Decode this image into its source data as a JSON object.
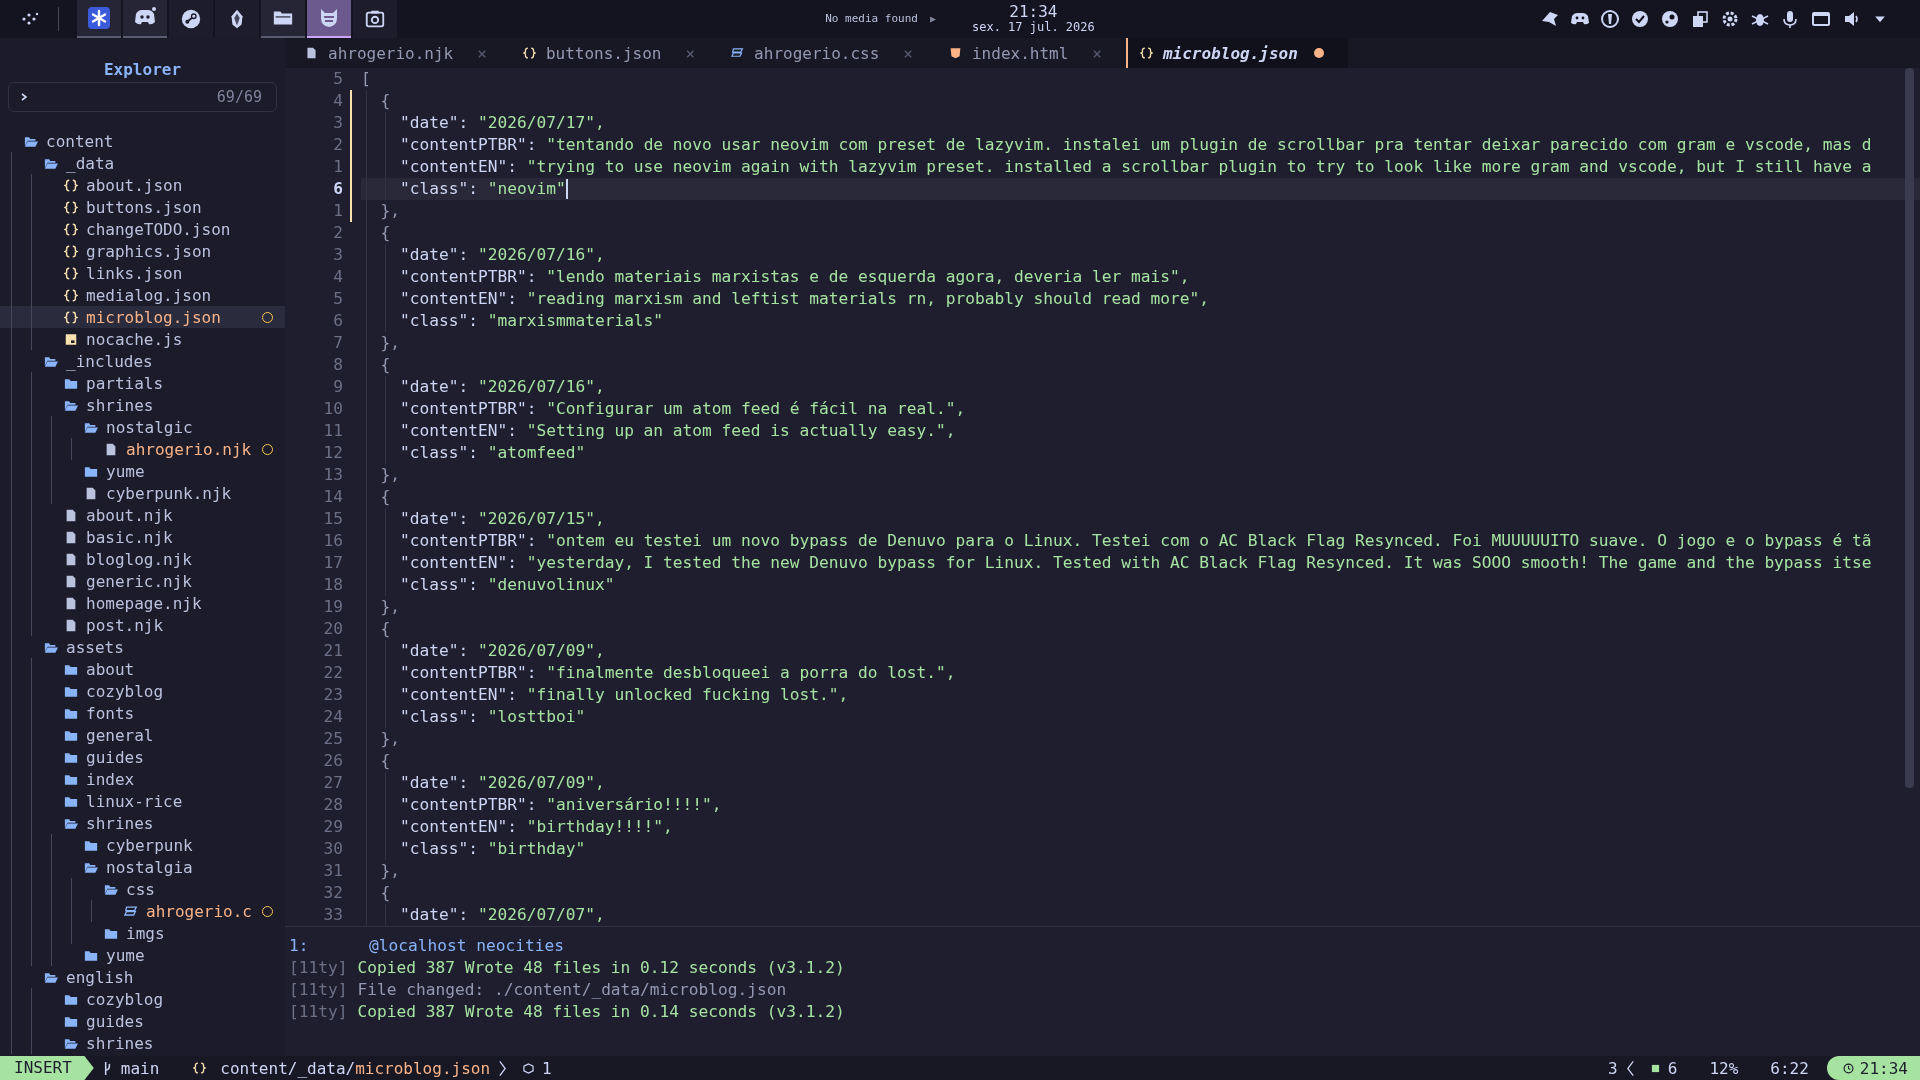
{
  "top_bar": {
    "apps": [
      {
        "selected": false,
        "open": true
      },
      {
        "selected": false,
        "open": true
      },
      {
        "selected": false,
        "open": false
      },
      {
        "selected": false,
        "open": false
      },
      {
        "selected": false,
        "open": true
      },
      {
        "selected": true,
        "open": true
      },
      {
        "selected": false,
        "open": false
      }
    ],
    "media": "No media found",
    "media_button": "▶",
    "time": "21:34",
    "date": "sex. 17 jul. 2026"
  },
  "sidebar": {
    "title": "Explorer",
    "count": "69/69",
    "tree": [
      {
        "name": "content",
        "kind": "folder",
        "expanded": true,
        "selected": false,
        "modified": false,
        "children": [
          {
            "name": "_data",
            "kind": "folder",
            "expanded": true,
            "selected": false,
            "modified": false,
            "children": [
              {
                "name": "about.json",
                "kind": "json",
                "selected": false,
                "modified": false
              },
              {
                "name": "buttons.json",
                "kind": "json",
                "selected": false,
                "modified": false
              },
              {
                "name": "changeTODO.json",
                "kind": "json",
                "selected": false,
                "modified": false
              },
              {
                "name": "graphics.json",
                "kind": "json",
                "selected": false,
                "modified": false
              },
              {
                "name": "links.json",
                "kind": "json",
                "selected": false,
                "modified": false
              },
              {
                "name": "medialog.json",
                "kind": "json",
                "selected": false,
                "modified": false
              },
              {
                "name": "microblog.json",
                "kind": "json",
                "selected": true,
                "modified": true
              },
              {
                "name": "nocache.js",
                "kind": "js",
                "selected": false,
                "modified": false
              }
            ]
          },
          {
            "name": "_includes",
            "kind": "folder",
            "expanded": true,
            "selected": false,
            "modified": false,
            "children": [
              {
                "name": "partials",
                "kind": "folder",
                "expanded": false,
                "selected": false,
                "modified": false
              },
              {
                "name": "shrines",
                "kind": "folder",
                "expanded": true,
                "selected": false,
                "modified": false,
                "children": [
                  {
                    "name": "nostalgic",
                    "kind": "folder",
                    "expanded": true,
                    "selected": false,
                    "modified": false,
                    "children": [
                      {
                        "name": "ahrogerio.njk",
                        "kind": "file",
                        "selected": false,
                        "modified": true
                      }
                    ]
                  },
                  {
                    "name": "yume",
                    "kind": "folder",
                    "expanded": false,
                    "selected": false,
                    "modified": false
                  },
                  {
                    "name": "cyberpunk.njk",
                    "kind": "file",
                    "selected": false,
                    "modified": false
                  }
                ]
              },
              {
                "name": "about.njk",
                "kind": "file",
                "selected": false,
                "modified": false
              },
              {
                "name": "basic.njk",
                "kind": "file",
                "selected": false,
                "modified": false
              },
              {
                "name": "bloglog.njk",
                "kind": "file",
                "selected": false,
                "modified": false
              },
              {
                "name": "generic.njk",
                "kind": "file",
                "selected": false,
                "modified": false
              },
              {
                "name": "homepage.njk",
                "kind": "file",
                "selected": false,
                "modified": false
              },
              {
                "name": "post.njk",
                "kind": "file",
                "selected": false,
                "modified": false
              }
            ]
          },
          {
            "name": "assets",
            "kind": "folder",
            "expanded": true,
            "selected": false,
            "modified": false,
            "children": [
              {
                "name": "about",
                "kind": "folder",
                "expanded": false,
                "selected": false,
                "modified": false
              },
              {
                "name": "cozyblog",
                "kind": "folder",
                "expanded": false,
                "selected": false,
                "modified": false
              },
              {
                "name": "fonts",
                "kind": "folder",
                "expanded": false,
                "selected": false,
                "modified": false
              },
              {
                "name": "general",
                "kind": "folder",
                "expanded": false,
                "selected": false,
                "modified": false
              },
              {
                "name": "guides",
                "kind": "folder",
                "expanded": false,
                "selected": false,
                "modified": false
              },
              {
                "name": "index",
                "kind": "folder",
                "expanded": false,
                "selected": false,
                "modified": false
              },
              {
                "name": "linux-rice",
                "kind": "folder",
                "expanded": false,
                "selected": false,
                "modified": false
              },
              {
                "name": "shrines",
                "kind": "folder",
                "expanded": true,
                "selected": false,
                "modified": false,
                "children": [
                  {
                    "name": "cyberpunk",
                    "kind": "folder",
                    "expanded": false,
                    "selected": false,
                    "modified": false
                  },
                  {
                    "name": "nostalgia",
                    "kind": "folder",
                    "expanded": true,
                    "selected": false,
                    "modified": false,
                    "children": [
                      {
                        "name": "css",
                        "kind": "folder",
                        "expanded": true,
                        "selected": false,
                        "modified": false,
                        "children": [
                          {
                            "name": "ahrogerio.c",
                            "kind": "css",
                            "selected": false,
                            "modified": true
                          }
                        ]
                      },
                      {
                        "name": "imgs",
                        "kind": "folder",
                        "expanded": false,
                        "selected": false,
                        "modified": false
                      }
                    ]
                  },
                  {
                    "name": "yume",
                    "kind": "folder",
                    "expanded": false,
                    "selected": false,
                    "modified": false
                  }
                ]
              }
            ]
          },
          {
            "name": "english",
            "kind": "folder",
            "expanded": true,
            "selected": false,
            "modified": false,
            "children": [
              {
                "name": "cozyblog",
                "kind": "folder",
                "expanded": false,
                "selected": false,
                "modified": false
              },
              {
                "name": "guides",
                "kind": "folder",
                "expanded": false,
                "selected": false,
                "modified": false
              },
              {
                "name": "shrines",
                "kind": "folder",
                "expanded": true,
                "selected": false,
                "modified": false
              }
            ]
          }
        ]
      }
    ]
  },
  "tabs": [
    {
      "label": "ahrogerio.njk",
      "kind": "file",
      "selected": false,
      "modified": false,
      "close": "×"
    },
    {
      "label": "buttons.json",
      "kind": "json",
      "selected": false,
      "modified": false,
      "close": "×"
    },
    {
      "label": "ahrogerio.css",
      "kind": "css",
      "selected": false,
      "modified": false,
      "close": "×"
    },
    {
      "label": "index.html",
      "kind": "html",
      "selected": false,
      "modified": false,
      "close": "×"
    },
    {
      "label": "microblog.json",
      "kind": "json",
      "selected": true,
      "modified": true
    }
  ],
  "code": {
    "first": {
      "number": "5",
      "text": "["
    },
    "entries": [
      {
        "changed": true,
        "open": {
          "number": "4",
          "text": "{"
        },
        "fields": [
          {
            "number": "3",
            "key": "\"date\":",
            "value": "\"2026/07/17\",",
            "current": false
          },
          {
            "number": "2",
            "key": "\"contentPTBR\":",
            "value": "\"tentando de novo usar neovim com preset de lazyvim. instalei um plugin de scrollbar pra tentar deixar parecido com gram e vscode, mas d",
            "current": false
          },
          {
            "number": "1",
            "key": "\"contentEN\":",
            "value": "\"trying to use neovim again with lazyvim preset. installed a scrollbar plugin to try to look like more gram and vscode, but I still have a",
            "current": false
          },
          {
            "number": "6",
            "key": "\"class\":",
            "value": "\"neovim\"",
            "current": true
          }
        ],
        "close": {
          "number": "1",
          "text": "},"
        }
      },
      {
        "changed": false,
        "open": {
          "number": "2",
          "text": "{"
        },
        "fields": [
          {
            "number": "3",
            "key": "\"date\":",
            "value": "\"2026/07/16\",",
            "current": false
          },
          {
            "number": "4",
            "key": "\"contentPTBR\":",
            "value": "\"lendo materiais marxistas e de esquerda agora, deveria ler mais\",",
            "current": false
          },
          {
            "number": "5",
            "key": "\"contentEN\":",
            "value": "\"reading marxism and leftist materials rn, probably should read more\",",
            "current": false
          },
          {
            "number": "6",
            "key": "\"class\":",
            "value": "\"marxismmaterials\"",
            "current": false
          }
        ],
        "close": {
          "number": "7",
          "text": "},"
        }
      },
      {
        "changed": false,
        "open": {
          "number": "8",
          "text": "{"
        },
        "fields": [
          {
            "number": "9",
            "key": "\"date\":",
            "value": "\"2026/07/16\",",
            "current": false
          },
          {
            "number": "10",
            "key": "\"contentPTBR\":",
            "value": "\"Configurar um atom feed é fácil na real.\",",
            "current": false
          },
          {
            "number": "11",
            "key": "\"contentEN\":",
            "value": "\"Setting up an atom feed is actually easy.\",",
            "current": false
          },
          {
            "number": "12",
            "key": "\"class\":",
            "value": "\"atomfeed\"",
            "current": false
          }
        ],
        "close": {
          "number": "13",
          "text": "},"
        }
      },
      {
        "changed": false,
        "open": {
          "number": "14",
          "text": "{"
        },
        "fields": [
          {
            "number": "15",
            "key": "\"date\":",
            "value": "\"2026/07/15\",",
            "current": false
          },
          {
            "number": "16",
            "key": "\"contentPTBR\":",
            "value": "\"ontem eu testei um novo bypass de Denuvo para o Linux. Testei com o AC Black Flag Resynced. Foi MUUUUUITO suave. O jogo e o bypass é tã",
            "current": false
          },
          {
            "number": "17",
            "key": "\"contentEN\":",
            "value": "\"yesterday, I tested the new Denuvo bypass for Linux. Tested with AC Black Flag Resynced. It was SOOO smooth! The game and the bypass itse",
            "current": false
          },
          {
            "number": "18",
            "key": "\"class\":",
            "value": "\"denuvolinux\"",
            "current": false
          }
        ],
        "close": {
          "number": "19",
          "text": "},"
        }
      },
      {
        "changed": false,
        "open": {
          "number": "20",
          "text": "{"
        },
        "fields": [
          {
            "number": "21",
            "key": "\"date\":",
            "value": "\"2026/07/09\",",
            "current": false
          },
          {
            "number": "22",
            "key": "\"contentPTBR\":",
            "value": "\"finalmente desbloqueei a porra do lost.\",",
            "current": false
          },
          {
            "number": "23",
            "key": "\"contentEN\":",
            "value": "\"finally unlocked fucking lost.\",",
            "current": false
          },
          {
            "number": "24",
            "key": "\"class\":",
            "value": "\"losttboi\"",
            "current": false
          }
        ],
        "close": {
          "number": "25",
          "text": "},"
        }
      },
      {
        "changed": false,
        "open": {
          "number": "26",
          "text": "{"
        },
        "fields": [
          {
            "number": "27",
            "key": "\"date\":",
            "value": "\"2026/07/09\",",
            "current": false
          },
          {
            "number": "28",
            "key": "\"contentPTBR\":",
            "value": "\"aniversário!!!!\",",
            "current": false
          },
          {
            "number": "29",
            "key": "\"contentEN\":",
            "value": "\"birthday!!!!\",",
            "current": false
          },
          {
            "number": "30",
            "key": "\"class\":",
            "value": "\"birthday\"",
            "current": false
          }
        ],
        "close": {
          "number": "31",
          "text": "},"
        }
      },
      {
        "changed": false,
        "open": {
          "number": "32",
          "text": "{"
        },
        "fields": [
          {
            "number": "33",
            "key": "\"date\":",
            "value": "\"2026/07/07\",",
            "current": false
          }
        ]
      }
    ]
  },
  "terminal": {
    "header": {
      "number": "1:",
      "text": "@localhost neocities"
    },
    "lines": [
      {
        "prefix": "[11ty]",
        "text": "Copied 387 Wrote 48 files in 0.12 seconds (v3.1.2)",
        "kind": "success"
      },
      {
        "prefix": "[11ty]",
        "text": "File changed: ./content/_data/microblog.json",
        "kind": "info"
      },
      {
        "prefix": "[11ty]",
        "text": "Copied 387 Wrote 48 files in 0.14 seconds (v3.1.2)",
        "kind": "success"
      }
    ]
  },
  "status_bar": {
    "mode": "INSERT",
    "branch": "main",
    "path": "content/_data/",
    "file": "microblog.json",
    "issues": "1",
    "warnings": "3",
    "lines_changed": "6",
    "progress": "12%",
    "position": "6:22",
    "time": "21:34"
  }
}
